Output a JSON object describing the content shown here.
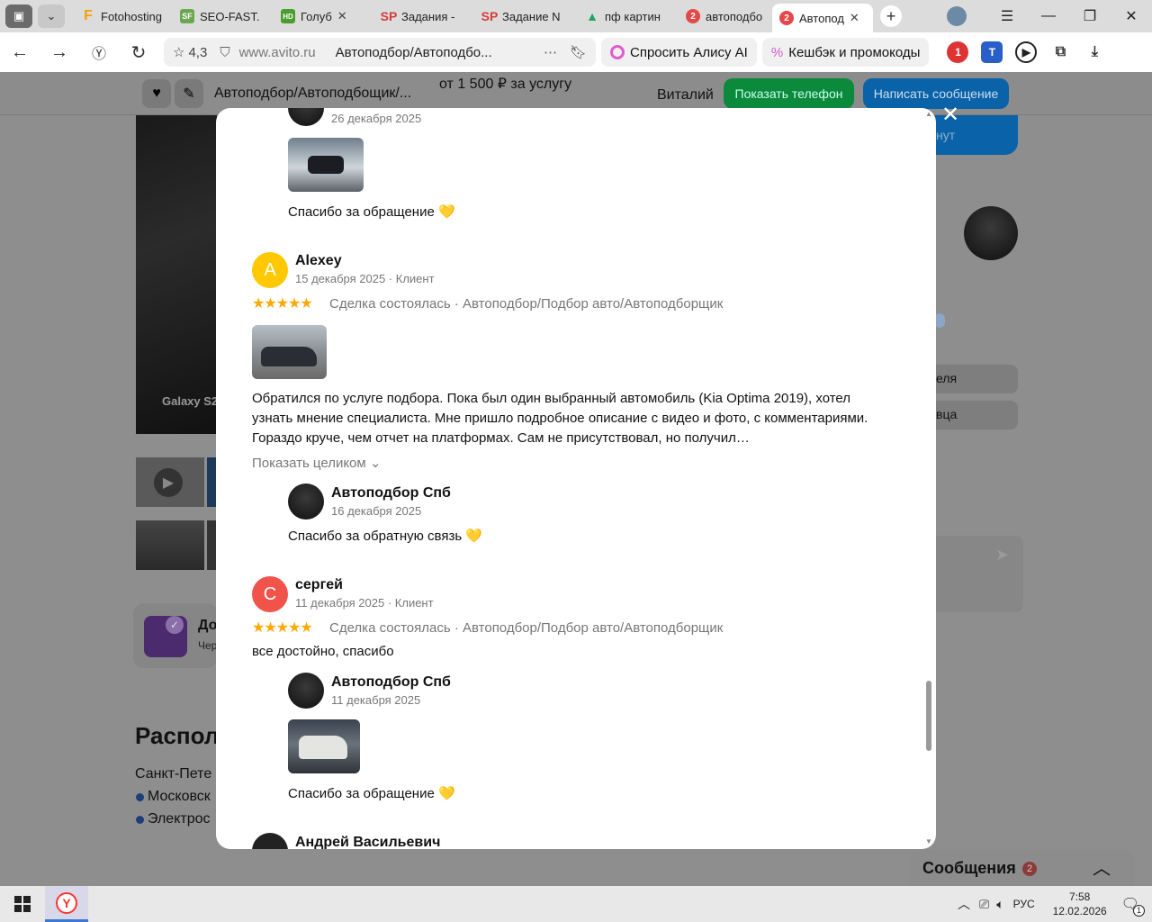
{
  "browser": {
    "tabs": [
      {
        "title": "Fotohosting",
        "icon": "F",
        "color": "#f5a000"
      },
      {
        "title": "SEO-FAST.",
        "icon": "SF",
        "color": "#5a9f3a"
      },
      {
        "title": "Голуб",
        "icon": "HD",
        "color": "#4c9c2e"
      },
      {
        "title": "Задания - ",
        "icon": "SP",
        "color": "#d63b3b"
      },
      {
        "title": "Задание N",
        "icon": "SP",
        "color": "#d63b3b"
      },
      {
        "title": "пф картин",
        "icon": "gdrive-icon",
        "color": "#1fa463"
      },
      {
        "title": "автоподбо",
        "icon": "2",
        "color": "#e54848"
      },
      {
        "title": "Автопод",
        "icon": "2",
        "color": "#e54848"
      }
    ],
    "rating": "4,3",
    "url_domain": "www.avito.ru",
    "page_title": "Автоподбор/Автоподбо...",
    "alice_label": "Спросить Алису AI",
    "cashback_label": "Кешбэк и промокоды"
  },
  "page": {
    "header_title": "Автоподбор/Автоподбощик/...",
    "price": "от 1 500 ₽ за услугу",
    "seller_name": "Виталий",
    "show_phone": "Показать телефон",
    "write_message": "Написать сообщение",
    "bg_photo_caption": "Galaxy S2",
    "location_heading": "Распол",
    "city": "Санкт-Пете",
    "metro1": "Московск",
    "metro2": "Электрос",
    "side_btn1": "еля",
    "side_btn2": "вца",
    "doc_title": "До",
    "doc_sub": "Чер",
    "blue_card_text": "нут",
    "messages_label": "Сообщения",
    "messages_count": "2"
  },
  "modal": {
    "top_reply_date": "26 декабря 2025",
    "top_reply_text": "Спасибо за обращение 💛",
    "reviews": [
      {
        "initial": "A",
        "name": "Alexey",
        "date": "15 декабря 2025 · Клиент",
        "stars": "★★★★★",
        "deal": "Сделка состоялась · Автоподбор/Подбор авто/Автоподборщик",
        "text": "Обратился по услуге подбора. Пока был один выбранный автомобиль (Kia Optima 2019), хотел узнать мнение специалиста. Мне пришло подробное описание с видео и фото, с комментариями. Гораздо круче, чем отчет на платформах. Сам не присутствовал, но получил…",
        "show_more": "Показать целиком ⌄",
        "reply_name": "Автоподбор Спб",
        "reply_date": "16 декабря 2025",
        "reply_text": "Спасибо за обратную связь 💛"
      },
      {
        "initial": "С",
        "name": "сергей",
        "date": "11 декабря 2025 · Клиент",
        "stars": "★★★★★",
        "deal": "Сделка состоялась · Автоподбор/Подбор авто/Автоподборщик",
        "text": "все достойно, спасибо",
        "reply_name": "Автоподбор Спб",
        "reply_date": "11 декабря 2025",
        "reply_text": "Спасибо за обращение 💛"
      }
    ],
    "next_reviewer": "Андрей Васильевич"
  },
  "taskbar": {
    "lang": "РУС",
    "time": "7:58",
    "date": "12.02.2026",
    "notif_count": "1"
  }
}
